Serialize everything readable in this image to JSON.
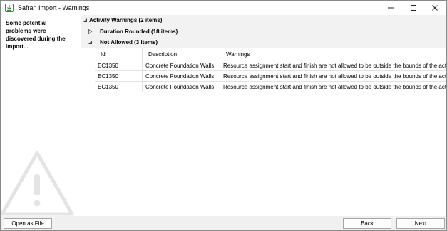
{
  "window": {
    "title": "Safran Import - Warnings",
    "icon": "import-download-icon"
  },
  "sidebar": {
    "message": "Some potential problems were discovered during the import..."
  },
  "groups": {
    "activity": "Activity Warnings (2 items)",
    "duration": "Duration Rounded (18 items)",
    "not_allowed": "Not Allowed (3 items)"
  },
  "table": {
    "headers": [
      "Id",
      "Description",
      "Warnings"
    ],
    "rows": [
      [
        "EC1350",
        "Concrete Foundation Walls",
        "Resource assignment start and finish are not allowed to be outside the bounds of the activity"
      ],
      [
        "EC1350",
        "Concrete Foundation Walls",
        "Resource assignment start and finish are not allowed to be outside the bounds of the activity"
      ],
      [
        "EC1350",
        "Concrete Foundation Walls",
        "Resource assignment start and finish are not allowed to be outside the bounds of the activity"
      ]
    ]
  },
  "footer": {
    "open_file": "Open as File",
    "back": "Back",
    "next": "Next"
  }
}
